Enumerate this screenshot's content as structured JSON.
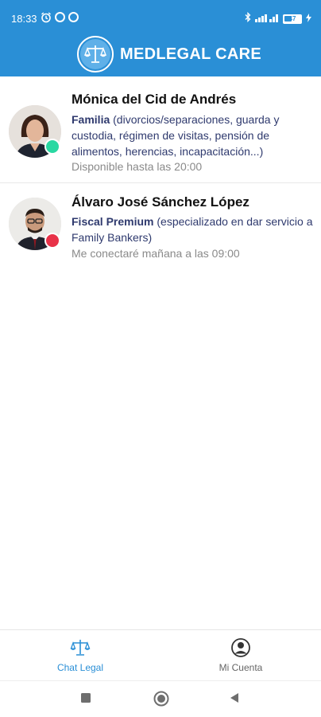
{
  "status_bar": {
    "time": "18:33",
    "battery_level": "47",
    "battery_fraction": 0.47
  },
  "header": {
    "brand": "MEDLEGAL CARE",
    "logo_icon": "scales-of-justice-icon",
    "background_color": "#2a8fd6"
  },
  "lawyers": [
    {
      "name": "Mónica del Cid de Andrés",
      "specialty": "Familia",
      "description": "(divorcios/separaciones, guarda y custodia, régimen de visitas, pensión de alimentos, herencias, incapacitación...)",
      "availability": "Disponible hasta las 20:00",
      "status": "online",
      "status_color": "#29d8a2"
    },
    {
      "name": "Álvaro José Sánchez López",
      "specialty": "Fiscal Premium",
      "description": "(especializado en dar servicio a Family Bankers)",
      "availability": "Me conectaré mañana a las 09:00",
      "status": "offline",
      "status_color": "#e83248"
    }
  ],
  "bottom_nav": {
    "tabs": [
      {
        "label": "Chat Legal",
        "icon": "scales-icon",
        "active": true
      },
      {
        "label": "Mi Cuenta",
        "icon": "user-account-icon",
        "active": false
      }
    ],
    "active_color": "#2a8fd6"
  },
  "system_nav": {
    "buttons": [
      "recents-square-icon",
      "home-circle-icon",
      "back-triangle-icon"
    ]
  }
}
